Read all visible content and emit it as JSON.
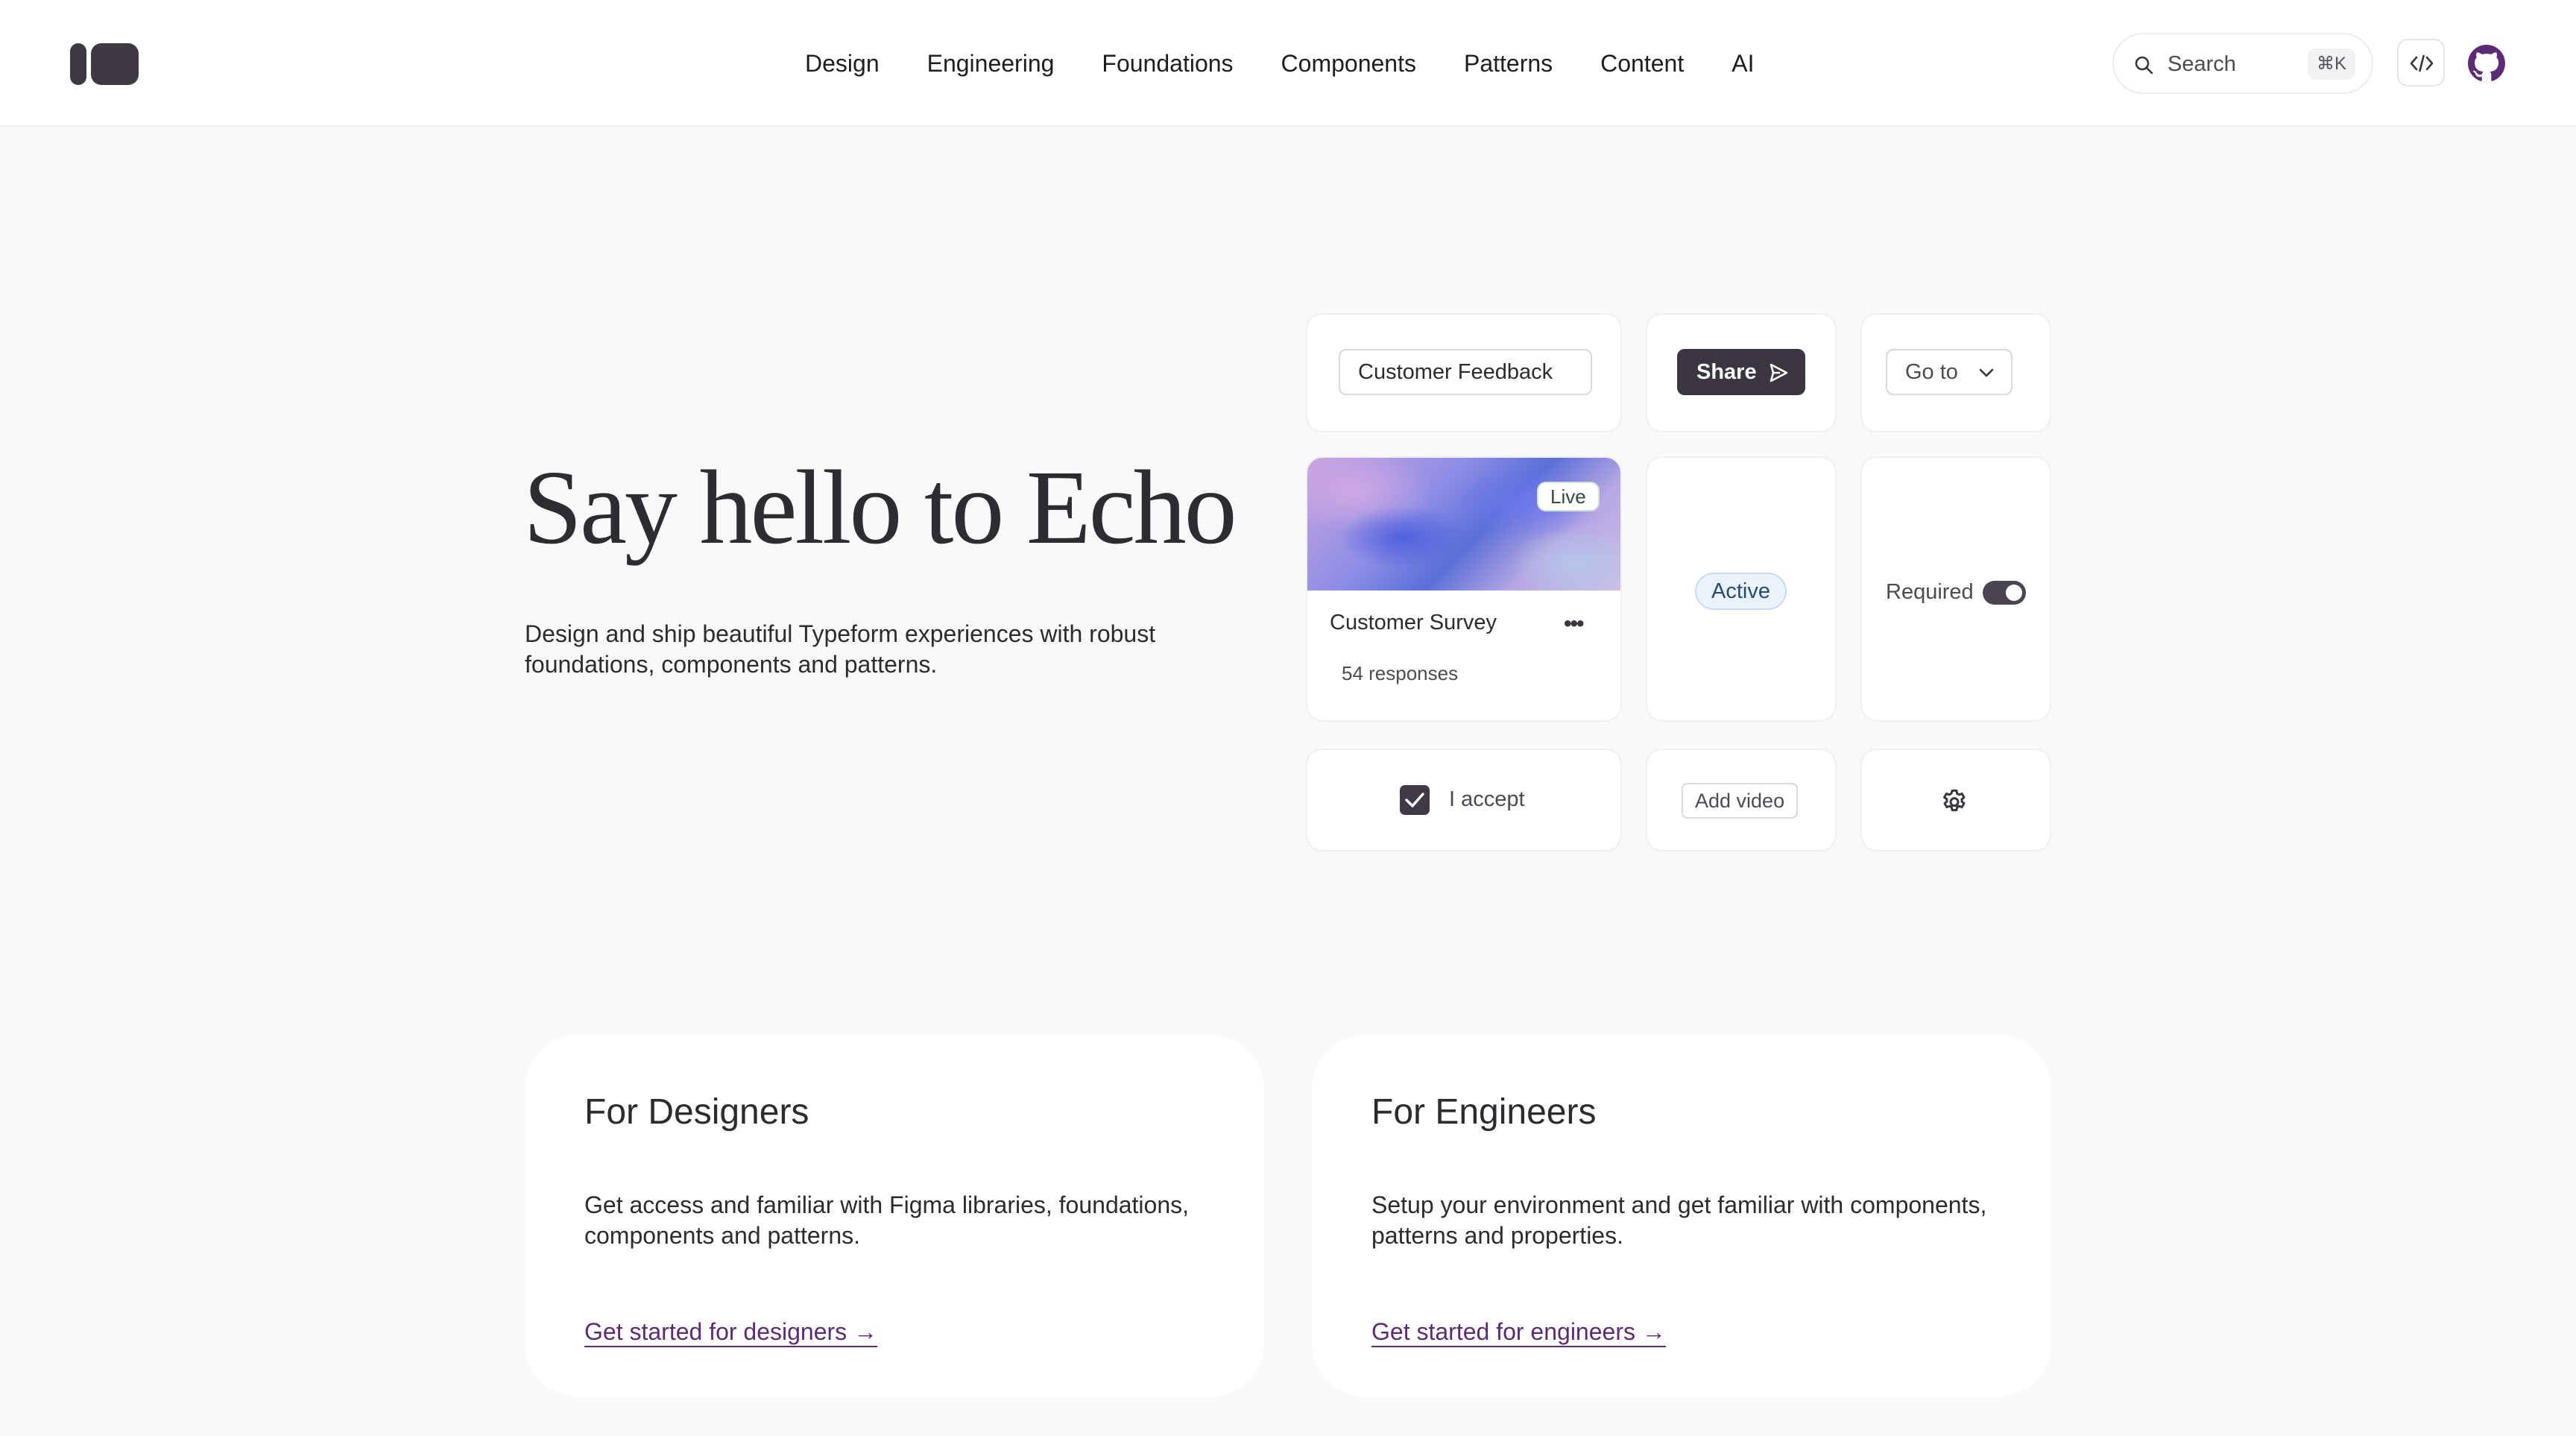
{
  "header": {
    "nav": [
      "Design",
      "Engineering",
      "Foundations",
      "Components",
      "Patterns",
      "Content",
      "AI"
    ],
    "search": {
      "label": "Search",
      "shortcut": "⌘K"
    }
  },
  "hero": {
    "title": "Say hello to Echo",
    "subtitle": "Design and ship beautiful Typeform experiences with robust foundations, components and patterns."
  },
  "showcase": {
    "form_name": "Customer Feedback",
    "share_label": "Share",
    "goto_label": "Go to",
    "survey": {
      "badge": "Live",
      "title": "Customer Survey",
      "more": "•••",
      "responses": "54 responses"
    },
    "status_badge": "Active",
    "toggle": {
      "label": "Required",
      "on": true
    },
    "checkbox": {
      "label": "I accept",
      "checked": true
    },
    "add_video_label": "Add video"
  },
  "cards": [
    {
      "title": "For Designers",
      "text": "Get access and familiar with Figma libraries, foundations, components and patterns.",
      "link": "Get started for designers →"
    },
    {
      "title": "For Engineers",
      "text": "Setup your environment and get familiar with components, patterns and properties.",
      "link": "Get started for engineers →"
    }
  ],
  "colors": {
    "accent_link": "#5d2b75",
    "dark_button": "#3a353f",
    "github_icon": "#5d2b75"
  },
  "icons": [
    "logo",
    "search-icon",
    "code-icon",
    "github-icon",
    "send-icon",
    "chevron-down-icon",
    "check-icon",
    "gear-icon"
  ]
}
